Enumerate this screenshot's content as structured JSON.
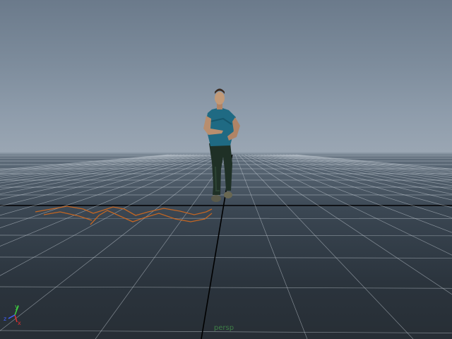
{
  "viewport": {
    "camera_label": "persp",
    "axis_labels": {
      "x": "x",
      "y": "y",
      "z": "z"
    }
  },
  "colors": {
    "sky_top": "#6b7a8b",
    "horizon": "#9aa6b3",
    "ground": "#2b343d",
    "grid_line": "#c8d0d8",
    "axis_line": "#000000",
    "motion_path": "#d2691e",
    "camera_label": "#3e7f47",
    "axis_x": "#e03030",
    "axis_y": "#40d040",
    "axis_z": "#4060ff"
  },
  "icons": {
    "character": "character-figure",
    "motion_path": "motion-path-curve",
    "view_axis": "view-axis-gizmo"
  }
}
